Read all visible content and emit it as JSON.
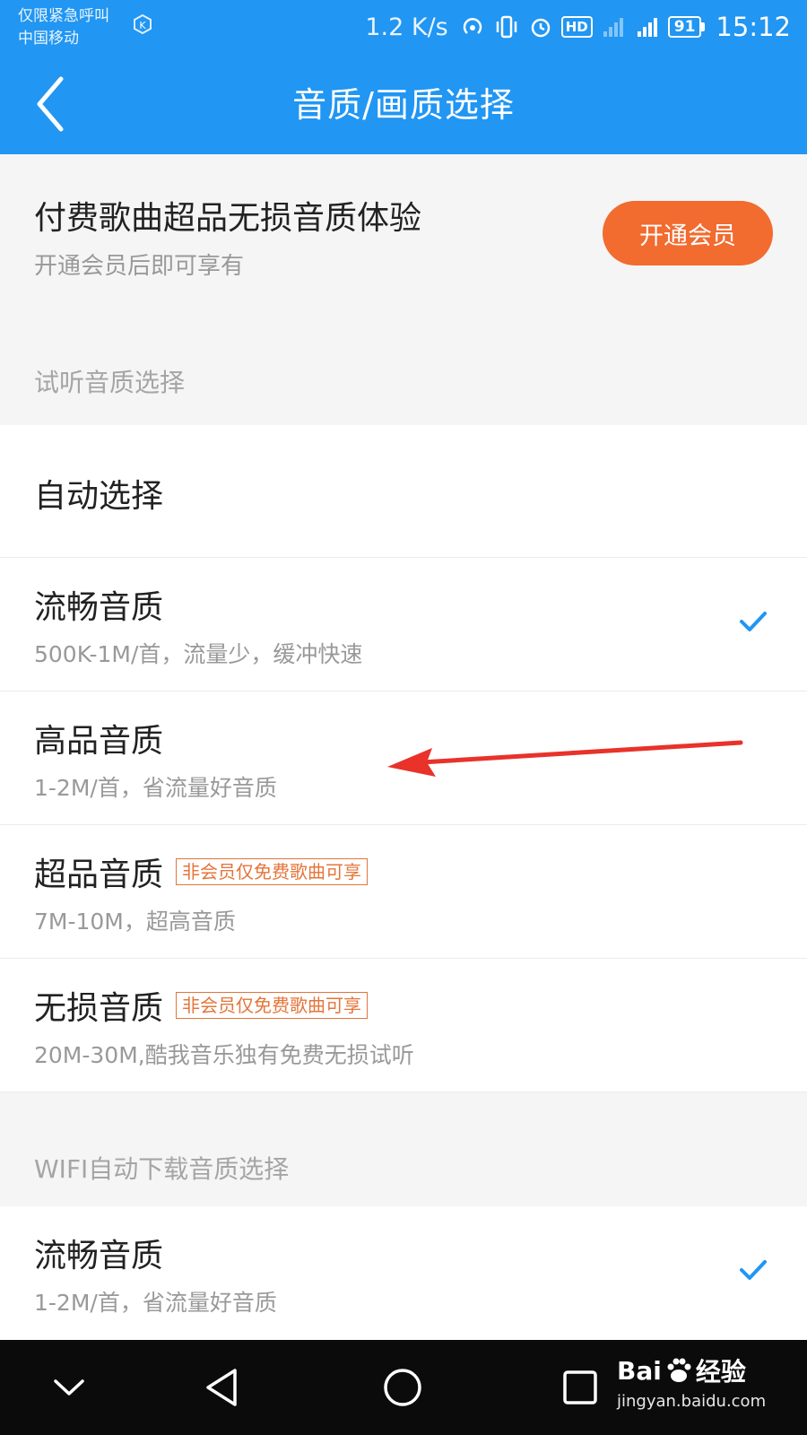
{
  "status_bar": {
    "carrier_line1": "仅限紧急呼叫",
    "carrier_line2": "中国移动",
    "speed": "1.2 K/s",
    "hd": "HD",
    "battery": "91",
    "time": "15:12"
  },
  "header": {
    "title": "音质/画质选择"
  },
  "promo": {
    "title": "付费歌曲超品无损音质体验",
    "subtitle": "开通会员后即可享有",
    "button": "开通会员"
  },
  "colors": {
    "primary": "#2196f3",
    "accent": "#f26b2f",
    "badge": "#e4753a",
    "annotation": "#e8322a"
  },
  "listen_section": {
    "label": "试听音质选择",
    "items": [
      {
        "title": "自动选择",
        "subtitle": "",
        "badge": "",
        "selected": false
      },
      {
        "title": "流畅音质",
        "subtitle": "500K-1M/首，流量少，缓冲快速",
        "badge": "",
        "selected": true
      },
      {
        "title": "高品音质",
        "subtitle": "1-2M/首，省流量好音质",
        "badge": "",
        "selected": false
      },
      {
        "title": "超品音质",
        "subtitle": "7M-10M，超高音质",
        "badge": "非会员仅免费歌曲可享",
        "selected": false
      },
      {
        "title": "无损音质",
        "subtitle": "20M-30M,酷我音乐独有免费无损试听",
        "badge": "非会员仅免费歌曲可享",
        "selected": false
      }
    ]
  },
  "wifi_section": {
    "label": "WIFI自动下载音质选择",
    "items": [
      {
        "title": "流畅音质",
        "subtitle": "1-2M/首，省流量好音质",
        "selected": true
      }
    ]
  },
  "watermark": {
    "brand": "Bai",
    "brand_suffix": "经验",
    "url": "jingyan.baidu.com"
  },
  "icons": [
    "back-icon",
    "check-icon",
    "annotation-arrow",
    "nav-down-icon",
    "nav-back-icon",
    "nav-home-icon",
    "nav-recent-icon"
  ]
}
